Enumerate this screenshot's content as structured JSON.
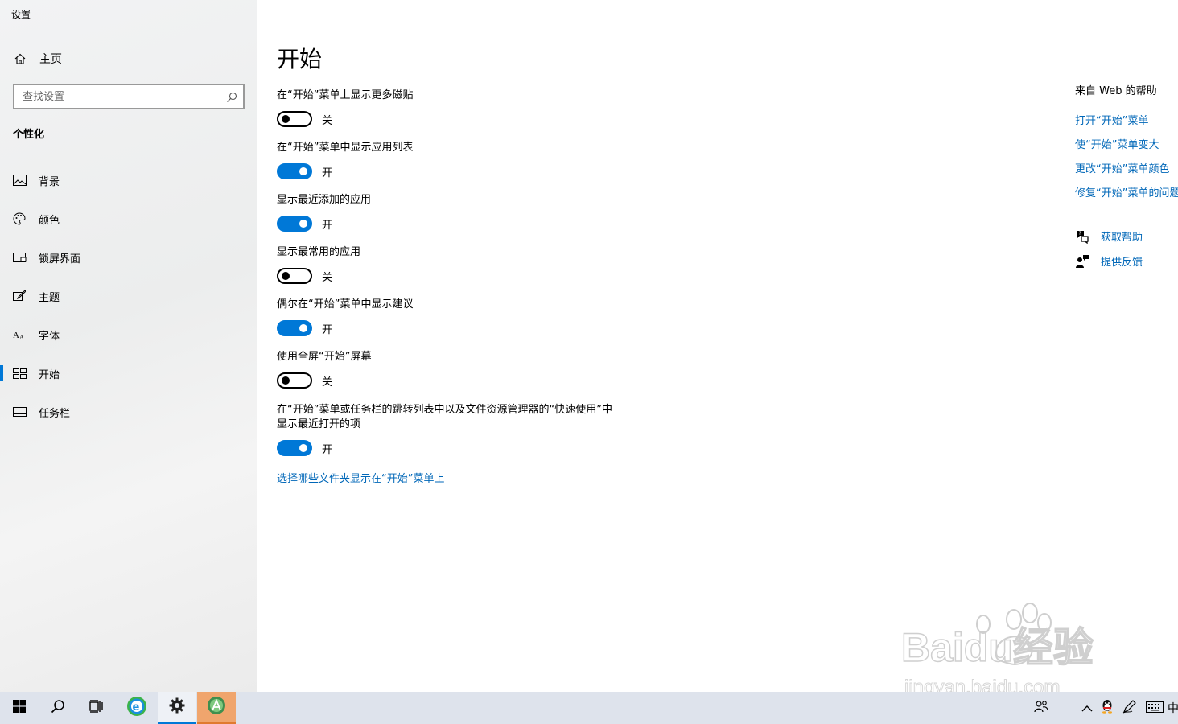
{
  "window": {
    "title": "设置"
  },
  "sidebar": {
    "home": {
      "label": "主页",
      "icon": "home-icon"
    },
    "search": {
      "placeholder": "查找设置",
      "icon": "search-icon"
    },
    "section": "个性化",
    "items": [
      {
        "label": "背景",
        "icon": "picture-icon",
        "active": false
      },
      {
        "label": "颜色",
        "icon": "palette-icon",
        "active": false
      },
      {
        "label": "锁屏界面",
        "icon": "lock-screen-icon",
        "active": false
      },
      {
        "label": "主题",
        "icon": "theme-brush-icon",
        "active": false
      },
      {
        "label": "字体",
        "icon": "font-icon",
        "active": false
      },
      {
        "label": "开始",
        "icon": "start-tiles-icon",
        "active": true
      },
      {
        "label": "任务栏",
        "icon": "taskbar-icon",
        "active": false
      }
    ]
  },
  "main": {
    "title": "开始",
    "settings": [
      {
        "label": "在“开始”菜单上显示更多磁贴",
        "on": false,
        "state": "关"
      },
      {
        "label": "在“开始”菜单中显示应用列表",
        "on": true,
        "state": "开"
      },
      {
        "label": "显示最近添加的应用",
        "on": true,
        "state": "开"
      },
      {
        "label": "显示最常用的应用",
        "on": false,
        "state": "关"
      },
      {
        "label": "偶尔在“开始”菜单中显示建议",
        "on": true,
        "state": "开"
      },
      {
        "label": "使用全屏“开始”屏幕",
        "on": false,
        "state": "关"
      },
      {
        "label_line1": "在“开始”菜单或任务栏的跳转列表中以及文件资源管理器的“快速使用”中",
        "label_line2": "显示最近打开的项",
        "on": true,
        "state": "开"
      }
    ],
    "folders_link": "选择哪些文件夹显示在“开始”菜单上"
  },
  "help": {
    "title": "来自 Web 的帮助",
    "links": [
      "打开“开始”菜单",
      "使“开始”菜单变大",
      "更改“开始”菜单颜色",
      "修复“开始”菜单的问题"
    ],
    "get_help": "获取帮助",
    "feedback": "提供反馈"
  },
  "taskbar": {
    "apps": [
      "windows-start-icon",
      "search-icon",
      "task-view-icon",
      "browser-icon",
      "settings-gear-icon",
      "android-studio-icon"
    ],
    "ime": "中"
  },
  "watermark": {
    "text": "Baidu经验",
    "url_text": "jingyan.baidu.com"
  },
  "colors": {
    "accent": "#0078d7",
    "link": "#0067b8",
    "taskbar": "#dee3ec"
  }
}
